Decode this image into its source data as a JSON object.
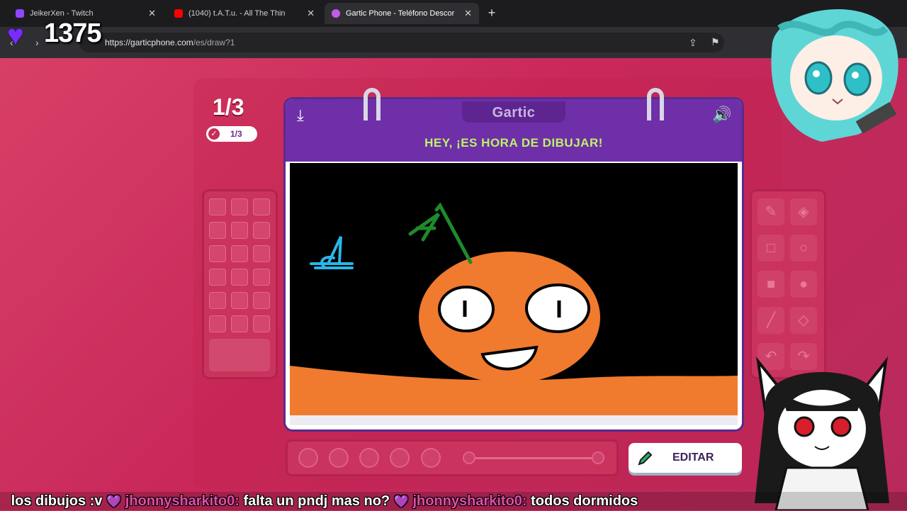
{
  "browser": {
    "tabs": [
      {
        "title": "JeikerXen - Twitch",
        "active": false,
        "favicon_color": "#9146ff"
      },
      {
        "title": "(1040) t.A.T.u. - All The Thin",
        "active": false,
        "favicon_color": "#ff0000"
      },
      {
        "title": "Gartic Phone - Teléfono Descor",
        "active": true,
        "favicon_color": "#c05ce8"
      }
    ],
    "url_host": "https://garticphone.com",
    "url_path": "/es/draw?1"
  },
  "overlay": {
    "heart_count": "1375"
  },
  "game": {
    "round_big": "1/3",
    "round_pill": "1/3",
    "logo": "Gartic",
    "headline": "HEY, ¡ES HORA DE DIBUJAR!",
    "edit_button": "EDITAR"
  },
  "chat": [
    {
      "user": "",
      "text": "los dibujos :v"
    },
    {
      "user": "jhonnysharkito0:",
      "text": "falta un pndj mas no?"
    },
    {
      "user": "jhonnysharkito0:",
      "text": "todos dormidos"
    }
  ],
  "colors": {
    "background": "#c92b55",
    "book_header": "#6f2fa8",
    "headline": "#bdf26a",
    "drawing_orange": "#f07a2e",
    "drawing_green": "#1f8a2a",
    "drawing_cyan": "#2ab6e8"
  }
}
